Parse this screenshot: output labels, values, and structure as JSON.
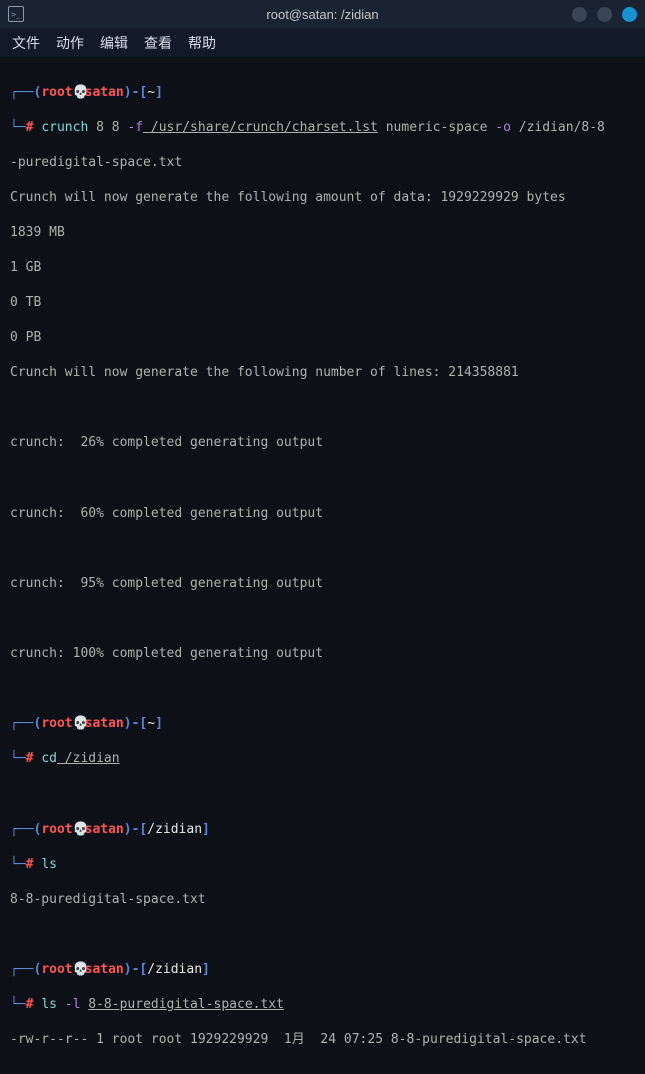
{
  "titlebar": {
    "title": "root@satan: /zidian"
  },
  "menubar": {
    "file": "文件",
    "actions": "动作",
    "edit": "编辑",
    "view": "查看",
    "help": "帮助"
  },
  "prompt": {
    "open1": "┌──(",
    "user": "root",
    "skull": "💀",
    "host": "satan",
    "close": ")-[",
    "end": "]",
    "line2": "└─",
    "hash": "#"
  },
  "paths": {
    "home": "~",
    "zidian": "/zidian"
  },
  "cmd1": {
    "bin": "crunch",
    "args1": " 8 8 ",
    "flag_f": "-f",
    "charset": " /usr/share/crunch/charset.lst",
    "args2": " numeric-space ",
    "flag_o": "-o",
    "outpath": " /zidian/8-8",
    "outpath2": "-puredigital-space.txt"
  },
  "output": {
    "l1": "Crunch will now generate the following amount of data: 1929229929 bytes",
    "l2": "1839 MB",
    "l3": "1 GB",
    "l4": "0 TB",
    "l5": "0 PB",
    "l6": "Crunch will now generate the following number of lines: 214358881",
    "p1": "crunch:  26% completed generating output",
    "p2": "crunch:  60% completed generating output",
    "p3": "crunch:  95% completed generating output",
    "p4": "crunch: 100% completed generating output"
  },
  "cmd2": {
    "bin": "cd",
    "arg": " /zidian"
  },
  "cmd3": {
    "bin": "ls",
    "out": "8-8-puredigital-space.txt"
  },
  "cmd4": {
    "bin": "ls",
    "flag": " -l ",
    "arg": "8-8-puredigital-space.txt",
    "out": "-rw-r--r-- 1 root root 1929229929  1月  24 07:25 8-8-puredigital-space.txt"
  }
}
